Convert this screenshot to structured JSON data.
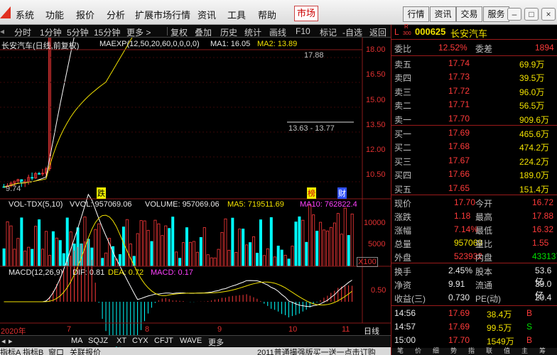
{
  "menubar": {
    "items": [
      "系统",
      "功能",
      "报价",
      "分析",
      "扩展市场行情",
      "资讯",
      "工具",
      "帮助"
    ],
    "market": "市场",
    "right_buttons": [
      "行情",
      "资讯",
      "交易",
      "服务"
    ]
  },
  "toolbar": {
    "items": [
      "分时",
      "1分钟",
      "5分钟",
      "15分钟",
      "更多 >",
      "复权",
      "叠加",
      "历史",
      "统计",
      "画线",
      "F10",
      "标记",
      "-自选",
      "返回"
    ]
  },
  "chart": {
    "title": "长安汽车(日线,前复权)",
    "ma_label": "MAEXP(12,50,20,60,0,0,0,0)",
    "ma1": "MA1: 16.05",
    "ma2": "MA2: 13.89",
    "price_ticks": [
      "18.00",
      "16.50",
      "15.00",
      "13.50",
      "12.00",
      "10.50"
    ],
    "high_label": "17.88",
    "low_label": "9.74",
    "range_label": "13.63 - 13.77",
    "markers": [
      "跌",
      "榜",
      "财"
    ],
    "vol_title": "VOL-TDX(5,10)",
    "vvol": "VVOL: 957069.06",
    "volume": "VOLUME: 957069.06",
    "ma5": "MA5: 719511.69",
    "ma10": "MA10: 762822.4",
    "vol_ticks": [
      "10000",
      "5000"
    ],
    "vol_unit": "X100",
    "macd_title": "MACD(12,26,9)",
    "dif": "DIF: 0.81",
    "dea": "DEA: 0.72",
    "macd": "MACD: 0.17",
    "macd_tick": "0.50",
    "x_labels": [
      "2020年",
      "7",
      "8",
      "9",
      "10",
      "11"
    ],
    "x_unit": "日线",
    "bottom_tabs": [
      "MA",
      "SQJZ",
      "XT",
      "CYX",
      "CFJT",
      "WAVE",
      "更多"
    ],
    "status": [
      "指标A",
      "指标B",
      "窗口",
      "关联报价"
    ],
    "ticker_msg": "2011普通撮强版买一送一点击订购"
  },
  "quote": {
    "l_badge": "L",
    "r_badge": "R",
    "r_num": "300",
    "code": "000625",
    "name": "长安汽车",
    "wb_label": "委比",
    "wb_value": "12.52%",
    "wc_label": "委差",
    "wc_value": "1894",
    "asks": [
      {
        "label": "卖五",
        "price": "17.74",
        "vol": "69.9万"
      },
      {
        "label": "卖四",
        "price": "17.73",
        "vol": "39.5万"
      },
      {
        "label": "卖三",
        "price": "17.72",
        "vol": "96.0万"
      },
      {
        "label": "卖二",
        "price": "17.71",
        "vol": "56.5万"
      },
      {
        "label": "卖一",
        "price": "17.70",
        "vol": "909.6万"
      }
    ],
    "bids": [
      {
        "label": "买一",
        "price": "17.69",
        "vol": "465.6万"
      },
      {
        "label": "买二",
        "price": "17.68",
        "vol": "474.2万"
      },
      {
        "label": "买三",
        "price": "17.67",
        "vol": "224.2万"
      },
      {
        "label": "买四",
        "price": "17.66",
        "vol": "189.0万"
      },
      {
        "label": "买五",
        "price": "17.65",
        "vol": "151.4万"
      }
    ],
    "stats": [
      {
        "l1": "现价",
        "v1": "17.70",
        "c1": "red",
        "l2": "今开",
        "v2": "16.72",
        "c2": "red"
      },
      {
        "l1": "涨跌",
        "v1": "1.18",
        "c1": "red",
        "l2": "最高",
        "v2": "17.88",
        "c2": "red"
      },
      {
        "l1": "涨幅",
        "v1": "7.14%",
        "c1": "red",
        "l2": "最低",
        "v2": "16.32",
        "c2": "red"
      },
      {
        "l1": "总量",
        "v1": "957069",
        "c1": "yel",
        "l2": "量比",
        "v2": "1.55",
        "c2": "red"
      },
      {
        "l1": "外盘",
        "v1": "523932",
        "c1": "red",
        "l2": "内盘",
        "v2": "433137",
        "c2": "green"
      }
    ],
    "stats2": [
      {
        "l1": "换手",
        "v1": "2.45%",
        "l2": "股本",
        "v2": "53.6亿"
      },
      {
        "l1": "净资",
        "v1": "9.91",
        "l2": "流通",
        "v2": "39.0亿"
      },
      {
        "l1": "收益(三)",
        "v1": "0.730",
        "l2": "PE(动)",
        "v2": "20.4"
      }
    ],
    "ticks": [
      {
        "time": "14:56",
        "price": "17.69",
        "vol": "38.4万",
        "side": "B"
      },
      {
        "time": "14:57",
        "price": "17.69",
        "vol": "99.5万",
        "side": "S"
      },
      {
        "time": "15:00",
        "price": "17.70",
        "vol": "1549万",
        "side": "B"
      }
    ],
    "bottom_tabs": [
      "笔",
      "价",
      "细",
      "势",
      "指",
      "联",
      "值",
      "主",
      "筹"
    ]
  },
  "colors": {
    "up": "#ff3a3a",
    "down": "#00ffff",
    "ma_white": "#ffffff",
    "ma_yellow": "#f0e000",
    "magenta": "#ff40ff"
  }
}
